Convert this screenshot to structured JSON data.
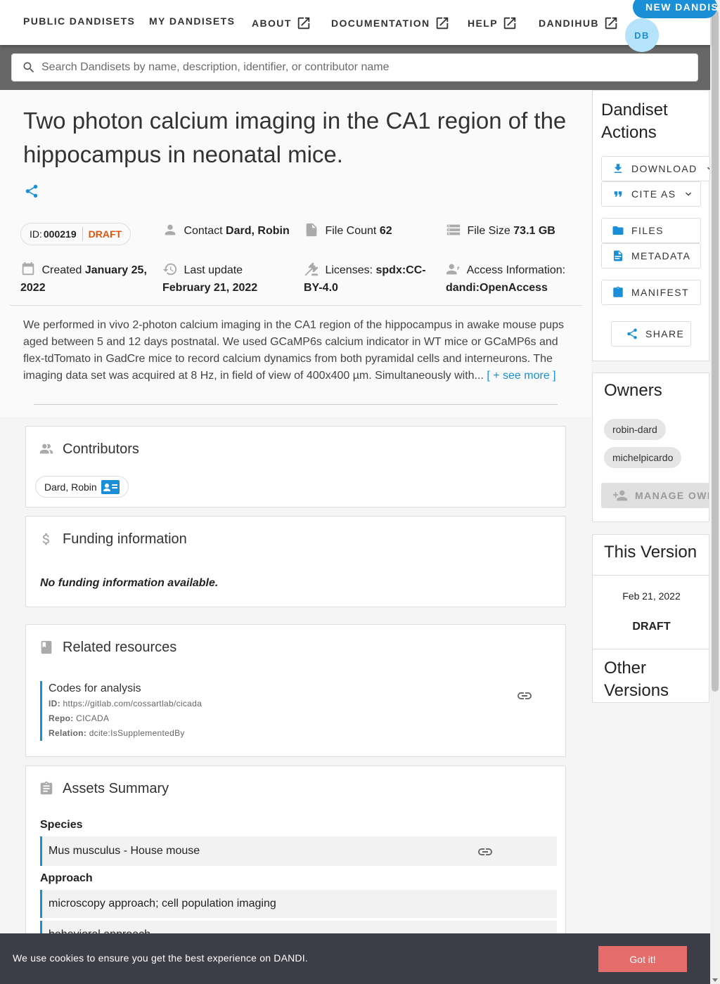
{
  "nav": {
    "items": [
      "PUBLIC DANDISETS",
      "MY DANDISETS",
      "ABOUT",
      "DOCUMENTATION",
      "HELP",
      "DANDIHUB"
    ],
    "new_button": "NEW DANDISET",
    "avatar": "DB"
  },
  "search": {
    "placeholder": "Search Dandisets by name, description, identifier, or contributor name"
  },
  "dandiset": {
    "title": "Two photon calcium imaging in the CA1 region of the hippocampus in neonatal mice.",
    "id_label": "ID:",
    "id": "000219",
    "status": "DRAFT",
    "contact_label": "Contact",
    "contact": "Dard, Robin",
    "file_count_label": "File Count",
    "file_count": "62",
    "file_size_label": "File Size",
    "file_size": "73.1 GB",
    "created_label": "Created",
    "created": "January 25, 2022",
    "updated_label": "Last update",
    "updated": "February 21, 2022",
    "license_label": "Licenses:",
    "license": "spdx:CC-BY-4.0",
    "access_label": "Access Information:",
    "access": "dandi:OpenAccess",
    "description": "We performed in vivo 2-photon calcium imaging in the CA1 region of the hippocampus in awake mouse pups aged between 5 and 12 days postnatal. We used GCaMP6s calcium indicator in WT mice or GCaMP6s and flex-tdTomato in GadCre mice to record calcium dynamics from both pyramidal cells and interneurons. The imaging data set was acquired at 8 Hz, in field of view of 400x400 µm. Simultaneously with...",
    "see_more": "[ + see more ]"
  },
  "contributors": {
    "title": "Contributors",
    "items": [
      "Dard, Robin"
    ]
  },
  "funding": {
    "title": "Funding information",
    "empty": "No funding information available."
  },
  "resources": {
    "title": "Related resources",
    "items": [
      {
        "name": "Codes for analysis",
        "id_label": "ID:",
        "id": "https://gitlab.com/cossartlab/cicada",
        "repo_label": "Repo:",
        "repo": "CICADA",
        "relation_label": "Relation:",
        "relation": "dcite:IsSupplementedBy"
      }
    ]
  },
  "assets": {
    "title": "Assets Summary",
    "species_label": "Species",
    "species": "Mus musculus - House mouse",
    "approach_label": "Approach",
    "approaches": [
      "microscopy approach; cell population imaging",
      "behavioral approach"
    ]
  },
  "actions": {
    "title": "Dandiset Actions",
    "download": "DOWNLOAD",
    "cite": "CITE AS",
    "files": "FILES",
    "metadata": "METADATA",
    "manifest": "MANIFEST",
    "share": "SHARE"
  },
  "owners": {
    "title": "Owners",
    "items": [
      "robin-dard",
      "michelpicardo"
    ],
    "manage": "MANAGE OWNERS"
  },
  "version": {
    "title": "This Version",
    "date": "Feb 21, 2022",
    "status": "DRAFT",
    "other_title": "Other Versions"
  },
  "cookie": {
    "text": "We use cookies to ensure you get the best experience on DANDI.",
    "button": "Got it!"
  },
  "colors": {
    "accent": "#1a8fd8",
    "draft": "#e2550d",
    "cookie_bg": "#3d3d47",
    "cookie_btn": "#e46d6b"
  }
}
